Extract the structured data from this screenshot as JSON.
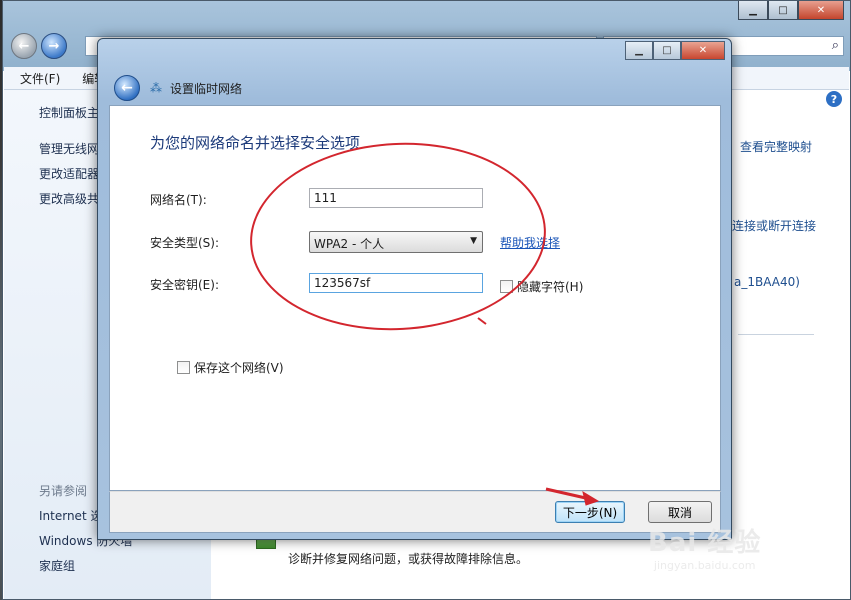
{
  "background_window": {
    "menu": [
      "文件(F)",
      "编辑(E)"
    ],
    "left_links": [
      "控制面板主页",
      "管理无线网络",
      "更改适配器设置",
      "更改高级共享设置"
    ],
    "see_also_header": "另请参阅",
    "see_also_links": [
      "Internet 选项",
      "Windows 防火墙",
      "家庭组"
    ],
    "right_links": {
      "full_map": "查看完整映射",
      "connect_disconnect": "连接或断开连接",
      "network_id": "a_1BAA40)"
    },
    "bottom_text": "诊断并修复网络问题，或获得故障排除信息。",
    "help_icon_label": "?"
  },
  "dialog": {
    "title": "设置临时网络",
    "heading": "为您的网络命名并选择安全选项",
    "network_name_label": "网络名(T):",
    "network_name_value": "111",
    "security_type_label": "安全类型(S):",
    "security_type_value": "WPA2 - 个人",
    "help_link": "帮助我选择",
    "security_key_label": "安全密钥(E):",
    "security_key_value": "123567sf",
    "hide_chars_label": "隐藏字符(H)",
    "save_network_label": "保存这个网络(V)",
    "next_button": "下一步(N)",
    "cancel_button": "取消"
  },
  "watermark": {
    "brand": "Bai  经验",
    "url": "jingyan.baidu.com"
  },
  "colors": {
    "annotation_red": "#d3262e",
    "link_blue": "#1a55b8",
    "heading_blue": "#1c3a7a"
  }
}
